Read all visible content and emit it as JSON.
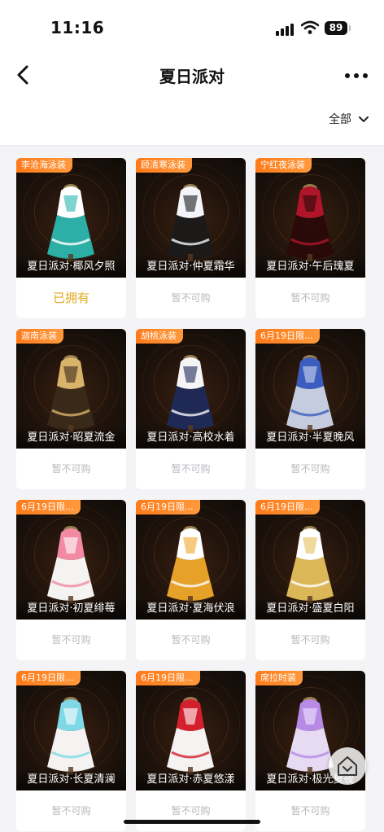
{
  "status_bar": {
    "time": "11:16",
    "battery": "89"
  },
  "nav": {
    "title": "夏日派对"
  },
  "filter": {
    "label": "全部"
  },
  "items": [
    {
      "tag": "李沧海泳装",
      "name": "夏日派对·椰风夕照",
      "status": "已拥有",
      "colors": [
        "#ffffff",
        "#2bb7b0"
      ]
    },
    {
      "tag": "顾清寒泳装",
      "name": "夏日派对·仲夏霜华",
      "status": "暂不可购",
      "colors": [
        "#f3f5fa",
        "#1a1a1a"
      ]
    },
    {
      "tag": "宁红夜泳装",
      "name": "夏日派对·午后瑰夏",
      "status": "暂不可购",
      "colors": [
        "#b0152a",
        "#2a0a0a"
      ]
    },
    {
      "tag": "迦南泳装",
      "name": "夏日派对·昭夏流金",
      "status": "暂不可购",
      "colors": [
        "#d9b36a",
        "#3a2a1a"
      ]
    },
    {
      "tag": "胡桃泳装",
      "name": "夏日派对·高校水着",
      "status": "暂不可购",
      "colors": [
        "#f5f5f5",
        "#1f2a5a"
      ]
    },
    {
      "tag": "6月19日限...",
      "name": "夏日派对·半夏晚风",
      "status": "暂不可购",
      "colors": [
        "#3a5dbf",
        "#cfd6ec"
      ]
    },
    {
      "tag": "6月19日限...",
      "name": "夏日派对·初夏绯莓",
      "status": "暂不可购",
      "colors": [
        "#f28aa3",
        "#ffffff"
      ]
    },
    {
      "tag": "6月19日限...",
      "name": "夏日派对·夏海伏浪",
      "status": "暂不可购",
      "colors": [
        "#ffffff",
        "#f0a92b"
      ]
    },
    {
      "tag": "6月19日限...",
      "name": "夏日派对·盛夏白阳",
      "status": "暂不可购",
      "colors": [
        "#ffffff",
        "#e6c05c"
      ]
    },
    {
      "tag": "6月19日限...",
      "name": "夏日派对·长夏清澜",
      "status": "暂不可购",
      "colors": [
        "#7fd8e6",
        "#ffffff"
      ]
    },
    {
      "tag": "6月19日限...",
      "name": "夏日派对·赤夏悠漾",
      "status": "暂不可购",
      "colors": [
        "#d4202e",
        "#ffffff"
      ]
    },
    {
      "tag": "席拉时装",
      "name": "夏日派对·极光夏夜",
      "status": "暂不可购",
      "colors": [
        "#b78ae6",
        "#f0e6ff"
      ]
    }
  ],
  "theme": {
    "accent_orange": "#ff7a1a",
    "owned_gold": "#e2a91f",
    "disabled_gray": "#b8b8bf"
  }
}
